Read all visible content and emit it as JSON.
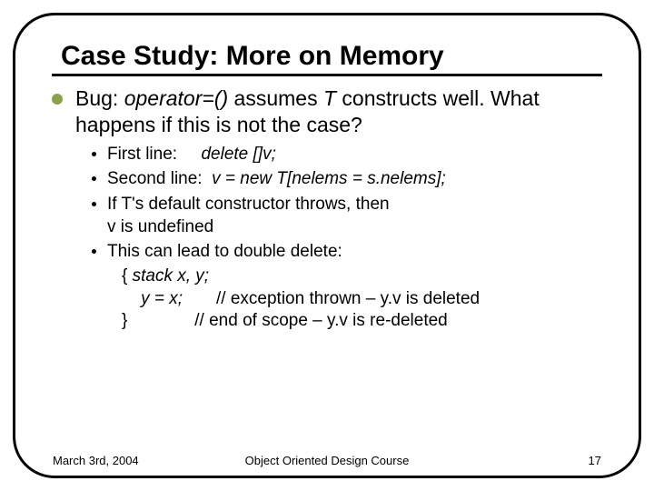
{
  "title": "Case Study: More on Memory",
  "bullet": {
    "prefix": "Bug: ",
    "opitalic": "operator=()",
    "mid": " assumes ",
    "t": "T",
    "rest": " constructs well. What happens if this is not the case?"
  },
  "sub": {
    "a_label": "First line:",
    "a_code": "delete []v;",
    "b_label": "Second line:",
    "b_code": "v = new T[nelems = s.nelems];",
    "c_line1": "If T's default constructor throws, then",
    "c_line2": "v is undefined",
    "d_intro": "This can lead to double delete:",
    "d_code1_a": "{ ",
    "d_code1_b": "stack x, y;",
    "d_code2_a": "    y = x;",
    "d_code2_b": "       // exception thrown – y.v is deleted",
    "d_code3_a": "}",
    "d_code3_b": "              // end of scope – y.v is re-deleted"
  },
  "footer": {
    "date": "March 3rd, 2004",
    "course": "Object Oriented Design Course",
    "page": "17"
  }
}
